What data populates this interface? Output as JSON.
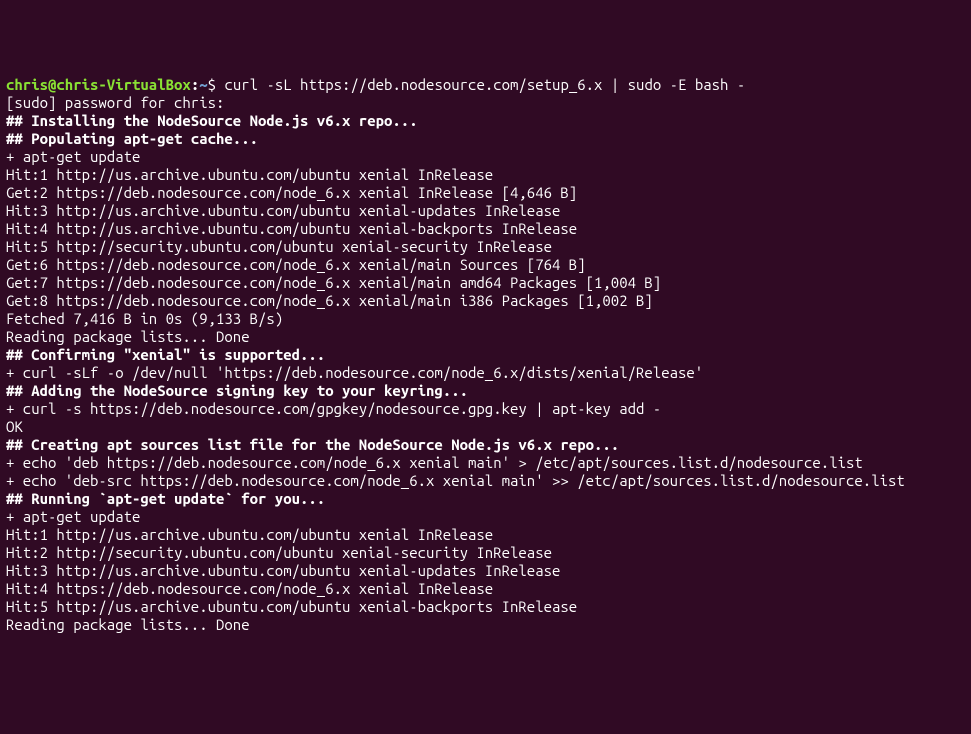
{
  "prompt": {
    "user_host": "chris@chris-VirtualBox",
    "separator": ":",
    "path": "~",
    "symbol": "$"
  },
  "command": "curl -sL https://deb.nodesource.com/setup_6.x | sudo -E bash -",
  "sudo_prompt": "[sudo] password for chris:",
  "blank": "",
  "h1": "## Installing the NodeSource Node.js v6.x repo...",
  "h2": "## Populating apt-get cache...",
  "l1": "+ apt-get update",
  "l2": "Hit:1 http://us.archive.ubuntu.com/ubuntu xenial InRelease",
  "l3": "Get:2 https://deb.nodesource.com/node_6.x xenial InRelease [4,646 B]",
  "l4": "Hit:3 http://us.archive.ubuntu.com/ubuntu xenial-updates InRelease",
  "l5": "Hit:4 http://us.archive.ubuntu.com/ubuntu xenial-backports InRelease",
  "l6": "Hit:5 http://security.ubuntu.com/ubuntu xenial-security InRelease",
  "l7": "Get:6 https://deb.nodesource.com/node_6.x xenial/main Sources [764 B]",
  "l8": "Get:7 https://deb.nodesource.com/node_6.x xenial/main amd64 Packages [1,004 B]",
  "l9": "Get:8 https://deb.nodesource.com/node_6.x xenial/main i386 Packages [1,002 B]",
  "l10": "Fetched 7,416 B in 0s (9,133 B/s)",
  "l11": "Reading package lists... Done",
  "h3": "## Confirming \"xenial\" is supported...",
  "l12": "+ curl -sLf -o /dev/null 'https://deb.nodesource.com/node_6.x/dists/xenial/Release'",
  "h4": "## Adding the NodeSource signing key to your keyring...",
  "l13": "+ curl -s https://deb.nodesource.com/gpgkey/nodesource.gpg.key | apt-key add -",
  "l14": "OK",
  "h5": "## Creating apt sources list file for the NodeSource Node.js v6.x repo...",
  "l15": "+ echo 'deb https://deb.nodesource.com/node_6.x xenial main' > /etc/apt/sources.list.d/nodesource.list",
  "l16": "+ echo 'deb-src https://deb.nodesource.com/node_6.x xenial main' >> /etc/apt/sources.list.d/nodesource.list",
  "h6": "## Running `apt-get update` for you...",
  "l17": "+ apt-get update",
  "l18": "Hit:1 http://us.archive.ubuntu.com/ubuntu xenial InRelease",
  "l19": "Hit:2 http://security.ubuntu.com/ubuntu xenial-security InRelease",
  "l20": "Hit:3 http://us.archive.ubuntu.com/ubuntu xenial-updates InRelease",
  "l21": "Hit:4 https://deb.nodesource.com/node_6.x xenial InRelease",
  "l22": "Hit:5 http://us.archive.ubuntu.com/ubuntu xenial-backports InRelease",
  "l23": "Reading package lists... Done"
}
